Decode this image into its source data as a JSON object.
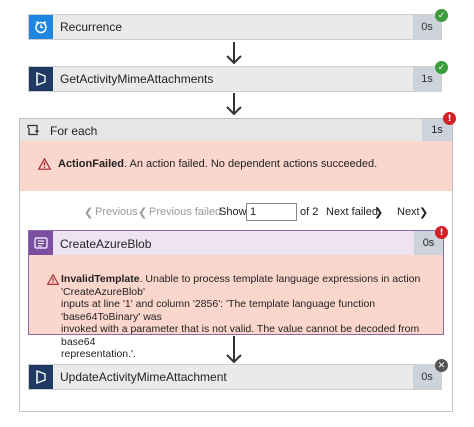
{
  "steps": {
    "recurrence": {
      "title": "Recurrence",
      "duration": "0s",
      "status_icon": "check-icon",
      "color": "#1f86e0"
    },
    "get_attachments": {
      "title": "GetActivityMimeAttachments",
      "duration": "1s",
      "status_icon": "check-icon",
      "color": "#1f3b63"
    },
    "for_each": {
      "title": "For each",
      "duration": "1s",
      "status_icon": "exclamation-icon"
    },
    "update_attachment": {
      "title": "UpdateActivityMimeAttachment",
      "duration": "0s",
      "status_icon": "close-icon",
      "color": "#1f3b63"
    }
  },
  "for_each_error": {
    "title": "ActionFailed",
    "message": ". An action failed. No dependent actions succeeded."
  },
  "pager": {
    "previous": "Previous",
    "previous_failed": "Previous failed",
    "show_label": "Show",
    "page_value": "1",
    "of_label": "of 2",
    "next_failed": "Next failed",
    "next": "Next"
  },
  "create_blob": {
    "title": "CreateAzureBlob",
    "duration": "0s",
    "error_title": "InvalidTemplate",
    "error_line1": ". Unable to process template language expressions in action 'CreateAzureBlob'",
    "error_line2": "inputs at line '1' and column '2856': 'The template language function 'base64ToBinary' was",
    "error_line3": "invoked with a parameter that is not valid. The value cannot be decoded from base64",
    "error_line4": "representation.'.",
    "color": "#7c4ea0"
  },
  "colors": {
    "success": "#3b9c3b",
    "error": "#d32127",
    "skipped": "#555555",
    "error_bg": "#fbd6cc"
  }
}
